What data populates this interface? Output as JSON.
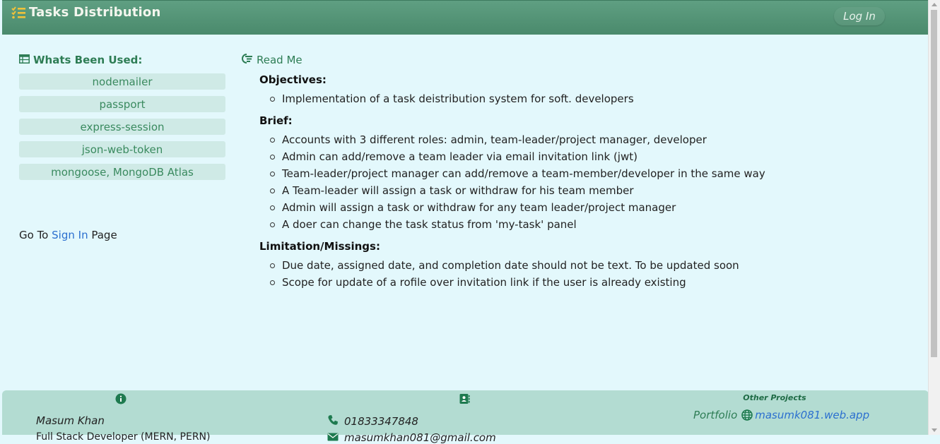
{
  "header": {
    "title": "Tasks Distribution",
    "login_label": "Log In"
  },
  "tools": {
    "heading": "Whats Been Used:",
    "items": [
      "nodemailer",
      "passport",
      "express-session",
      "json-web-token",
      "mongoose, MongoDB Atlas"
    ]
  },
  "goto": {
    "prefix": "Go To",
    "link": "Sign In",
    "suffix": "Page"
  },
  "readme": {
    "heading": "Read Me",
    "sections": [
      {
        "title": "Objectives:",
        "items": [
          "Implementation of a task deistribution system for soft. developers"
        ]
      },
      {
        "title": "Brief:",
        "items": [
          "Accounts with 3 different roles: admin, team-leader/project manager, developer",
          "Admin can add/remove a team leader via email invitation link (jwt)",
          "Team-leader/project manager can add/remove a team-member/developer in the same way",
          "A Team-leader will assign a task or withdraw for his team member",
          "Admin will assign a task or withdraw for any team leader/project manager",
          "A doer can change the task status from 'my-task' panel"
        ]
      },
      {
        "title": "Limitation/Missings:",
        "items": [
          "Due date, assigned date, and completion date should not be text. To be updated soon",
          "Scope for update of a rofile over invitation link if the user is already existing"
        ]
      }
    ]
  },
  "footer": {
    "name": "Masum Khan",
    "subtitle": "Full Stack Developer (MERN, PERN)",
    "phone": "01833347848",
    "email": "masumkhan081@gmail.com",
    "other_projects_title": "Other Projects",
    "portfolio_label": "Portfolio",
    "portfolio_link": "masumk081.web.app"
  },
  "colors": {
    "header": "#5f9f82",
    "page_bg": "#e3f8fc",
    "accent_green": "#2e7d55",
    "tool_bg": "#cfeae6",
    "footer_bg": "#b3dcd2",
    "link_blue": "#2b6fcf"
  },
  "icons": {
    "brand": "checklist-icon",
    "tools": "table-icon",
    "readme": "readme-icon",
    "info": "info-circle-icon",
    "contact": "address-book-icon",
    "phone": "phone-icon",
    "email": "envelope-icon",
    "globe": "globe-icon"
  }
}
